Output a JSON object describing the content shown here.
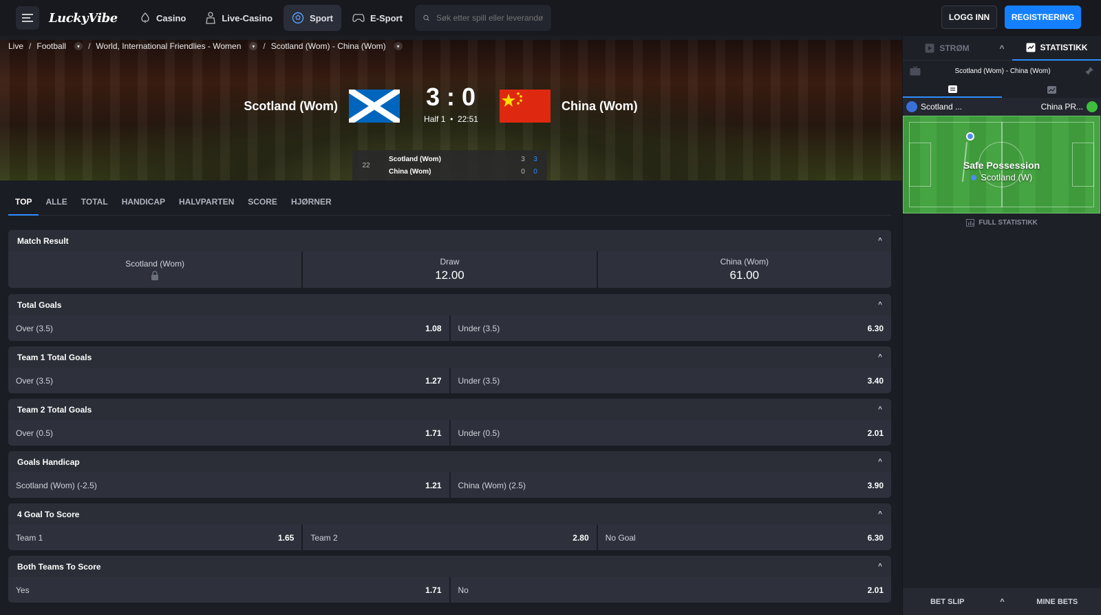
{
  "nav": {
    "logo": "LuckyVibe",
    "items": [
      {
        "label": "Casino",
        "icon": "casino-icon"
      },
      {
        "label": "Live-Casino",
        "icon": "dealer-icon"
      },
      {
        "label": "Sport",
        "icon": "football-icon"
      },
      {
        "label": "E-Sport",
        "icon": "gamepad-icon"
      }
    ],
    "search_placeholder": "Søk etter spill eller leverandør",
    "login": "LOGG INN",
    "register": "REGISTRERING"
  },
  "breadcrumb": [
    "Live",
    "Football",
    "World, International Friendlies - Women",
    "Scotland (Wom) - China (Wom)"
  ],
  "match": {
    "home": "Scotland (Wom)",
    "away": "China (Wom)",
    "score": "3 : 0",
    "period": "Half 1",
    "time": "22:51",
    "minute": "22",
    "board": [
      {
        "team": "Scotland (Wom)",
        "a": "3",
        "b": "3"
      },
      {
        "team": "China (Wom)",
        "a": "0",
        "b": "0"
      }
    ]
  },
  "tabs": [
    "TOP",
    "ALLE",
    "TOTAL",
    "HANDICAP",
    "HALVPARTEN",
    "SCORE",
    "HJØRNER"
  ],
  "markets": [
    {
      "title": "Match Result",
      "home": "Scotland (Wom)",
      "draw": "Draw",
      "draw_odd": "12.00",
      "away": "China (Wom)",
      "away_odd": "61.00"
    },
    {
      "title": "Total Goals",
      "outcomes": [
        {
          "label": "Over (3.5)",
          "odd": "1.08"
        },
        {
          "label": "Under (3.5)",
          "odd": "6.30"
        }
      ]
    },
    {
      "title": "Team 1 Total Goals",
      "outcomes": [
        {
          "label": "Over (3.5)",
          "odd": "1.27"
        },
        {
          "label": "Under (3.5)",
          "odd": "3.40"
        }
      ]
    },
    {
      "title": "Team 2 Total Goals",
      "outcomes": [
        {
          "label": "Over (0.5)",
          "odd": "1.71"
        },
        {
          "label": "Under (0.5)",
          "odd": "2.01"
        }
      ]
    },
    {
      "title": "Goals Handicap",
      "outcomes": [
        {
          "label": "Scotland (Wom) (-2.5)",
          "odd": "1.21"
        },
        {
          "label": "China (Wom) (2.5)",
          "odd": "3.90"
        }
      ]
    },
    {
      "title": "4 Goal To Score",
      "outcomes": [
        {
          "label": "Team 1",
          "odd": "1.65"
        },
        {
          "label": "Team 2",
          "odd": "2.80"
        },
        {
          "label": "No Goal",
          "odd": "6.30"
        }
      ]
    },
    {
      "title": "Both Teams To Score",
      "outcomes": [
        {
          "label": "Yes",
          "odd": "1.71"
        },
        {
          "label": "No",
          "odd": "2.01"
        }
      ]
    }
  ],
  "right_panel": {
    "stream_tab": "STRØM",
    "stats_tab": "STATISTIKK",
    "match_title": "Scotland (Wom) - China (Wom)",
    "team_home": "Scotland ...",
    "team_away": "China PR...",
    "pitch_status": "Safe Possession",
    "pitch_team": "Scotland (W)",
    "full_stats": "FULL STATISTIKK",
    "bet_slip": "BET SLIP",
    "my_bets": "MINE BETS"
  },
  "colors": {
    "accent": "#1580ff",
    "background": "#1b1d24",
    "panel": "#2e313b"
  }
}
